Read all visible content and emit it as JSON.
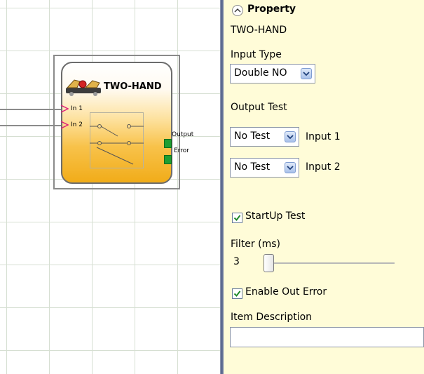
{
  "canvas": {
    "block": {
      "title": "TWO-HAND",
      "inputs": [
        "In 1",
        "In 2"
      ],
      "outputs": [
        "Output",
        "Error"
      ]
    }
  },
  "panel": {
    "title": "Property",
    "component_name": "TWO-HAND",
    "input_type": {
      "label": "Input Type",
      "value": "Double NO"
    },
    "output_test": {
      "label": "Output Test",
      "rows": [
        {
          "value": "No Test",
          "label": "Input 1"
        },
        {
          "value": "No Test",
          "label": "Input 2"
        }
      ]
    },
    "startup_test": {
      "label": "StartUp Test",
      "checked": true
    },
    "filter": {
      "label": "Filter (ms)",
      "value": "3"
    },
    "enable_out_error": {
      "label": "Enable Out Error",
      "checked": true
    },
    "item_description": {
      "label": "Item Description",
      "value": ""
    }
  },
  "colors": {
    "panel_bg": "#fffcd8",
    "port_green": "#1e9e32",
    "block_orange": "#f1ac19"
  }
}
